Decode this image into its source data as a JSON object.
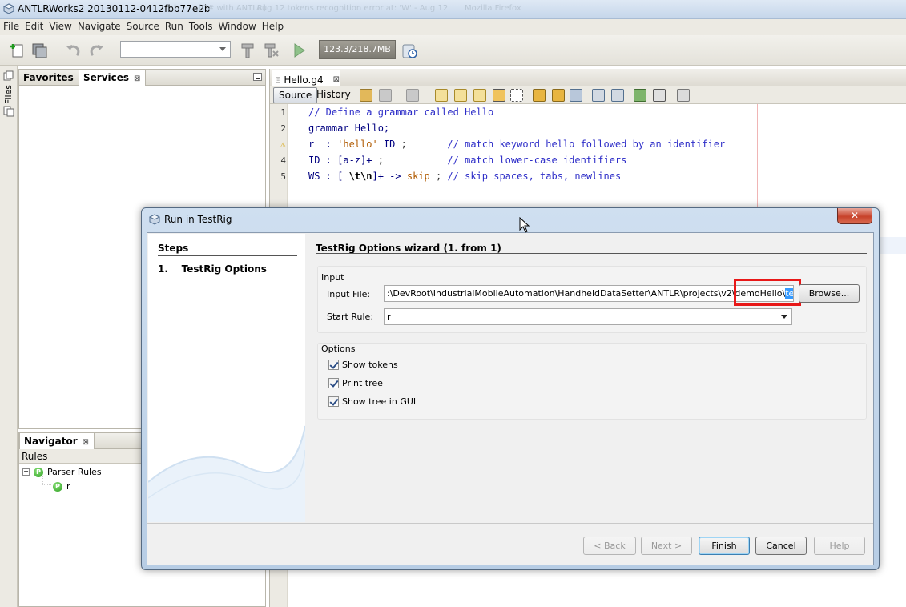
{
  "window": {
    "title": "ANTLRWorks2 20130112-0412fbb77e2b",
    "ghost_titles": [
      "[C# with ANTLR]",
      "Aug 12 tokens recognition error at: 'W' - Aug 12",
      "Mozilla Firefox"
    ]
  },
  "menu": [
    "File",
    "Edit",
    "View",
    "Navigate",
    "Source",
    "Run",
    "Tools",
    "Window",
    "Help"
  ],
  "toolbar": {
    "memory": "123.3/218.7MB",
    "config_combo_value": ""
  },
  "left_strip": {
    "files_label": "Files"
  },
  "services_panel": {
    "tabs": [
      {
        "label": "Favorites"
      },
      {
        "label": "Services",
        "close": "⊠"
      }
    ]
  },
  "navigator": {
    "title": "Navigator",
    "close": "⊠",
    "header": "Rules",
    "tree": [
      {
        "label": "Parser Rules",
        "badge": "P"
      },
      {
        "label": "r",
        "badge": "P"
      }
    ],
    "expander": "−"
  },
  "editor": {
    "tab_label": "Hello.g4",
    "tab_close": "⊠",
    "source_label": "Source",
    "history_label": "History",
    "line_numbers": [
      "1",
      "2",
      "",
      "4",
      "5"
    ],
    "warning_glyph": "⚠",
    "lines": [
      [
        {
          "t": "// Define a grammar called Hello",
          "c": "cmt"
        }
      ],
      [
        {
          "t": "grammar Hello;",
          "c": "kw"
        }
      ],
      [
        {
          "t": "r  : ",
          "c": "kw"
        },
        {
          "t": "'hello'",
          "c": "str"
        },
        {
          "t": " ID ",
          "c": "kw"
        },
        {
          "t": ";",
          "c": "dark"
        },
        {
          "t": "       // match keyword hello followed by an identifier",
          "c": "cmt"
        }
      ],
      [
        {
          "t": "ID : [a-z]+ ",
          "c": "kw"
        },
        {
          "t": ";",
          "c": "dark"
        },
        {
          "t": "           // match lower-case identifiers",
          "c": "cmt"
        }
      ],
      [
        {
          "t": "WS : [ ",
          "c": "kw"
        },
        {
          "t": "\\t\\n",
          "c": "bold"
        },
        {
          "t": "]+ -> ",
          "c": "kw"
        },
        {
          "t": "skip",
          "c": "str"
        },
        {
          "t": " ; ",
          "c": "dark"
        },
        {
          "t": "// skip spaces, tabs, newlines",
          "c": "cmt"
        }
      ]
    ]
  },
  "dialog": {
    "title": "Run in TestRig",
    "close_glyph": "✕",
    "steps_header": "Steps",
    "steps": [
      {
        "num": "1.",
        "label": "TestRig Options"
      }
    ],
    "wizard_header": "TestRig Options wizard (1. from 1)",
    "input_group": "Input",
    "input_file_label": "Input File:",
    "input_file_path": "\\DevRoot\\IndustrialMobileAutomation\\HandheldDataSetter\\ANTLR\\projects\\v2\\demoHello\\",
    "input_file_path_prefix": ":",
    "input_file_selected": "testInput.txt",
    "browse_label": "Browse...",
    "start_rule_label": "Start Rule:",
    "start_rule_value": "r",
    "options_group": "Options",
    "options": [
      {
        "label": "Show tokens",
        "checked": true
      },
      {
        "label": "Print tree",
        "checked": true
      },
      {
        "label": "Show tree in GUI",
        "checked": true
      }
    ],
    "buttons": {
      "back": "< Back",
      "next": "Next >",
      "finish": "Finish",
      "cancel": "Cancel",
      "help": "Help"
    }
  },
  "colors": {
    "accent_selection": "#3399ff",
    "highlight_box": "#e81818",
    "dialog_frame": "#b7cde5"
  }
}
